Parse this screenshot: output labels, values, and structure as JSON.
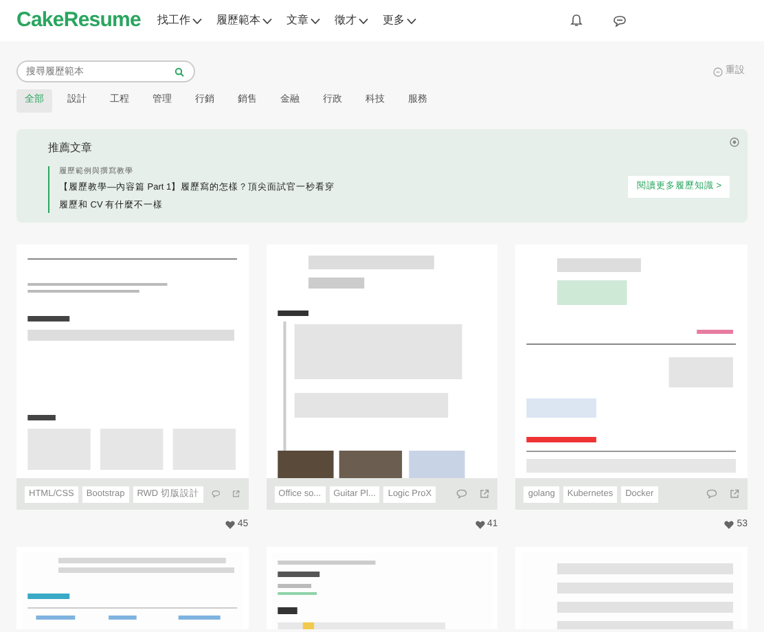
{
  "header": {
    "logo": "CakeResume",
    "nav": [
      {
        "label": "找工作"
      },
      {
        "label": "履歷範本"
      },
      {
        "label": "文章"
      },
      {
        "label": "徵才"
      },
      {
        "label": "更多"
      }
    ]
  },
  "search": {
    "placeholder": "搜尋履歷範本"
  },
  "reset": "重設",
  "categories": [
    {
      "label": "全部",
      "selected": true
    },
    {
      "label": "設計",
      "selected": false
    },
    {
      "label": "工程",
      "selected": false
    },
    {
      "label": "管理",
      "selected": false
    },
    {
      "label": "行銷",
      "selected": false
    },
    {
      "label": "銷售",
      "selected": false
    },
    {
      "label": "金融",
      "selected": false
    },
    {
      "label": "行政",
      "selected": false
    },
    {
      "label": "科技",
      "selected": false
    },
    {
      "label": "服務",
      "selected": false
    }
  ],
  "recommended": {
    "title": "推薦文章",
    "section": "履歷範例與撰寫教學",
    "articles": [
      "【履歷教學—內容篇 Part 1】履歷寫的怎樣？頂尖面試官一秒看穿",
      "履歷和 CV 有什麼不一樣"
    ],
    "more_button": "閱讀更多履歷知識 >"
  },
  "templates": [
    {
      "tags": [
        "HTML/CSS",
        "Bootstrap",
        "RWD 切版設計"
      ],
      "likes": "45"
    },
    {
      "tags": [
        "Office so...",
        "Guitar Pl...",
        "Logic ProX"
      ],
      "likes": "41"
    },
    {
      "tags": [
        "golang",
        "Kubernetes",
        "Docker"
      ],
      "likes": "53"
    }
  ]
}
